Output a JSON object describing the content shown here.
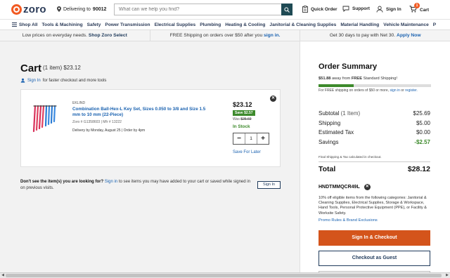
{
  "header": {
    "logo_text": "zoro",
    "deliver_label": "Delivering to",
    "zip": "90012",
    "search_placeholder": "What can we help you find?",
    "quick_order": "Quick Order",
    "support": "Support",
    "sign_in": "Sign In",
    "cart_label": "Cart",
    "cart_count": "1"
  },
  "nav": {
    "shop_all": "Shop All",
    "items": [
      "Tools & Machining",
      "Safety",
      "Power Transmission",
      "Electrical Supplies",
      "Plumbing",
      "Heating & Cooling",
      "Janitorial & Cleaning Supplies",
      "Material Handling",
      "Vehicle Maintenance",
      "P"
    ]
  },
  "promo": {
    "p1_text": "Low prices on everyday needs.",
    "p1_link": "Shop Zoro Select",
    "p2_text": "FREE Shipping on orders over $50 after you",
    "p2_link": "sign in.",
    "p3_text": "Get 30 days to pay with Net 30.",
    "p3_link": "Apply Now"
  },
  "cart": {
    "title": "Cart",
    "summary": "(1 item) $23.12",
    "signin_link": "Sign In",
    "signin_rest": "for faster checkout and more tools",
    "item": {
      "brand": "EKLIND",
      "name": "Combination Ball-Hex-L Key Set, Sizes 0.050 to 3/8 and Size 1.5 mm to 10 mm (22-Piece)",
      "meta": "Zoro # G1358603 | Mfr # 13222",
      "delivery": "Delivery by Monday, August 25 | Order by 4pm",
      "price": "$23.12",
      "save_badge": "Save $2.57",
      "was_label": "Was",
      "was_price": "$25.69",
      "stock": "In Stock",
      "qty": "1",
      "minus": "−",
      "plus": "+",
      "save_later": "Save For Later",
      "remove": "✕"
    },
    "dont_see_bold": "Don't see the item(s) you are looking for?",
    "dont_see_link": "Sign in",
    "dont_see_rest": "to see items you may have added to your cart or saved while signed in on previous visits.",
    "signin_button": "Sign In"
  },
  "summary": {
    "title": "Order Summary",
    "ship_amount": "$51.88",
    "ship_mid": "away from",
    "ship_free": "FREE",
    "ship_end": "Standard Shipping!",
    "progress_fraction": 0.31,
    "note_pre": "For FREE shipping on orders of $50 or more,",
    "note_link1": "sign in",
    "note_or": "or",
    "note_link2": "register.",
    "rows": [
      {
        "label": "Subtotal",
        "muted": "(1 Item)",
        "value": "$25.69"
      },
      {
        "label": "Shipping",
        "muted": "",
        "value": "$5.00"
      },
      {
        "label": "Estimated Tax",
        "muted": "",
        "value": "$0.00"
      },
      {
        "label": "Savings",
        "muted": "",
        "value": "-$2.57"
      }
    ],
    "calc_note": "Final Shipping & Tax calculated in checkout.",
    "total_label": "Total",
    "total_value": "$28.12",
    "coupon_code": "HNDTMMQCR49L",
    "coupon_desc": "10% off eligible items from the following categories: Janitorial & Cleaning Supplies, Electrical Supplies, Storage & Workspace, Hand Tools, Personal Protective Equipment (PPE), or Facility & Worksite Safety.",
    "promo_rules": "Promo Rules & Brand Exclusions",
    "btn_signin_checkout": "Sign In & Checkout",
    "btn_guest": "Checkout as Guest"
  },
  "colors": {
    "brand_orange": "#f15a22",
    "navy": "#1f3a5b",
    "green": "#3d8a2c",
    "link_blue": "#1a62b0",
    "checkout_orange": "#d4541b"
  }
}
